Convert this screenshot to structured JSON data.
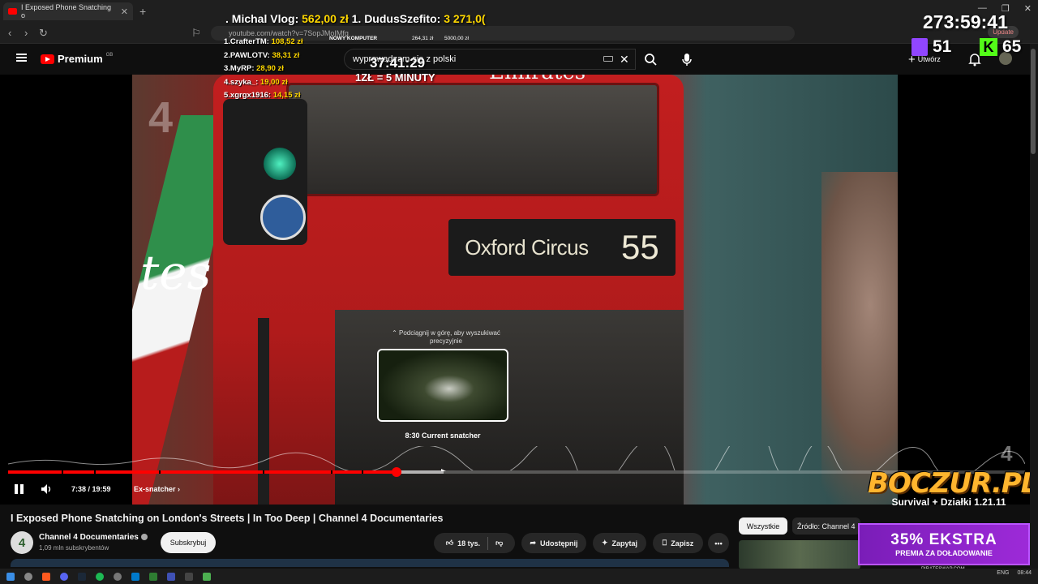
{
  "browser": {
    "tab_title": "I Exposed Phone Snatching o",
    "url": "youtube.com/watch?v=7SopJMoIMfg",
    "update_label": "Update"
  },
  "youtube": {
    "logo_text": "Premium",
    "region": "GB",
    "search_value": "wyprowadzam się z polski",
    "create_label": "Utwórz"
  },
  "video": {
    "destination": "Oxford Circus",
    "route": "55",
    "livery_text": "tes",
    "emirates_text": "Emirates",
    "scrub_hint": "⌃ Podciągnij w górę, aby wyszukiwać precyzyjnie",
    "preview_caption": "8:30  Current snatcher",
    "time_display": "7:38 / 19:59",
    "chapter": "Ex-snatcher",
    "progress_fraction": 0.3823,
    "buffer_fraction": 0.428,
    "channel_logo": "4"
  },
  "meta": {
    "title": "I Exposed Phone Snatching on London's Streets | In Too Deep | Channel 4 Documentaries",
    "channel": "Channel 4 Documentaries",
    "subs": "1,09 mln subskrybentów",
    "subscribe": "Subskrybuj",
    "likes": "18 tys.",
    "share": "Udostępnij",
    "ask": "Zapytaj",
    "save": "Zapisz",
    "chip_all": "Wszystkie",
    "chip_source": "Źródło: Channel 4"
  },
  "overlay": {
    "donation_prefix": ". Michal Vlog: ",
    "donation_1": "562,00 zł",
    "donation_mid": " 1. DudusSzefito: ",
    "donation_2": "3 271,0(",
    "donors": [
      {
        "name": "1.CrafterTM: ",
        "amount": "108,52 zł"
      },
      {
        "name": "2.PAWLOTV: ",
        "amount": "38,31 zł"
      },
      {
        "name": "3.MyRP: ",
        "amount": "28,90 zł"
      },
      {
        "name": "4.szyka_: ",
        "amount": "19,00 zł"
      },
      {
        "name": "5.xgrgx1916: ",
        "amount": "14,15 zł"
      }
    ],
    "goal_label": "NOWY KOMPUTER",
    "goal_progress": "264,31 zł",
    "goal_max": "5000,00 zł",
    "timer_small": "37:41:29",
    "rate": "1ZŁ = 5 MINUTY",
    "timer_big": "273:59:41",
    "twitch_viewers": "51",
    "kick_viewers": "65",
    "kick_letter": "K",
    "boczur_title": "BOCZUR.PL",
    "boczur_sub": "Survival + Działki 1.21.11",
    "promo_big": "35% EKSTRA",
    "promo_small": "PREMIA ZA DOŁADOWANIE",
    "promo_site": "PIRATESWAP.COM"
  },
  "tray": {
    "lang": "ENG",
    "time": "08:44"
  }
}
